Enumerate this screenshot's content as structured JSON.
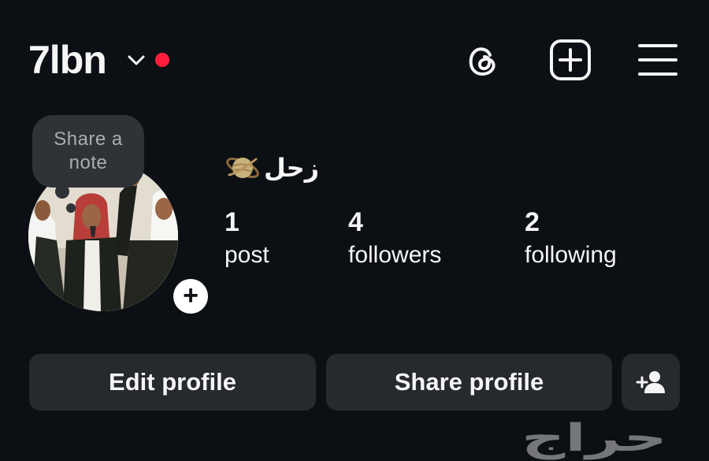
{
  "header": {
    "username": "7lbn",
    "icons": [
      "chevron-down-icon",
      "notification-dot",
      "threads-icon",
      "create-post-icon",
      "menu-icon"
    ]
  },
  "profile": {
    "note_prompt": "Share a note",
    "display_name": "زحل",
    "name_emoji": "saturn-icon"
  },
  "stats": [
    {
      "value": "1",
      "label": "post"
    },
    {
      "value": "4",
      "label": "followers"
    },
    {
      "value": "2",
      "label": "following"
    }
  ],
  "actions": {
    "edit": "Edit profile",
    "share": "Share profile",
    "suggest_icon": "add-person-icon"
  },
  "watermark": "حراج",
  "colors": {
    "background": "#0c0f14",
    "button": "#26292e",
    "notification": "#ff1f3d",
    "note_bubble": "#2f3337"
  }
}
